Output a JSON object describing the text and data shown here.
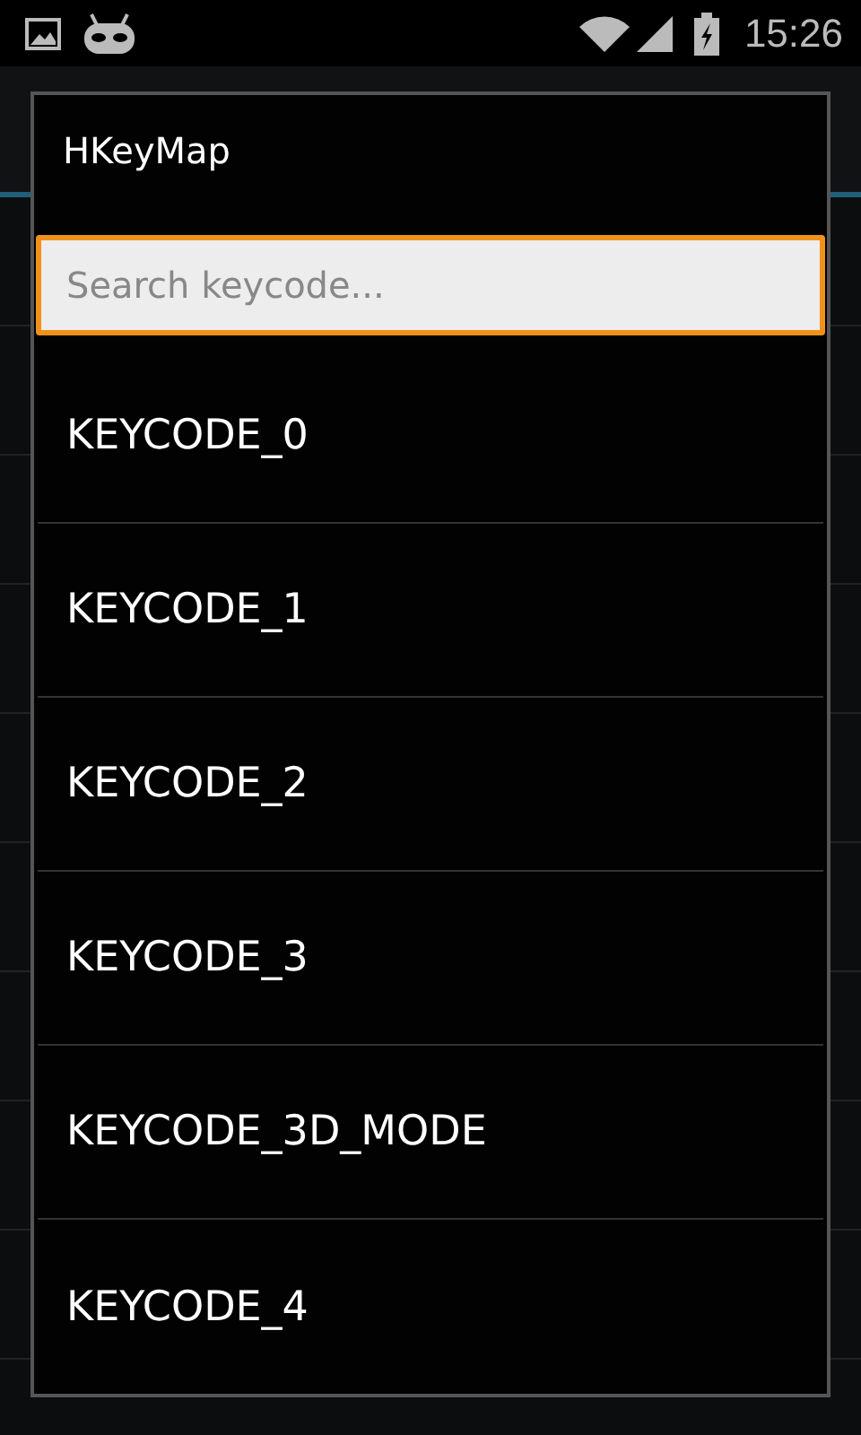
{
  "status_bar": {
    "time": "15:26"
  },
  "dialog": {
    "title": "HKeyMap",
    "search": {
      "placeholder": "Search keycode..."
    },
    "items": [
      {
        "label": "KEYCODE_0"
      },
      {
        "label": "KEYCODE_1"
      },
      {
        "label": "KEYCODE_2"
      },
      {
        "label": "KEYCODE_3"
      },
      {
        "label": "KEYCODE_3D_MODE"
      },
      {
        "label": "KEYCODE_4"
      }
    ]
  }
}
